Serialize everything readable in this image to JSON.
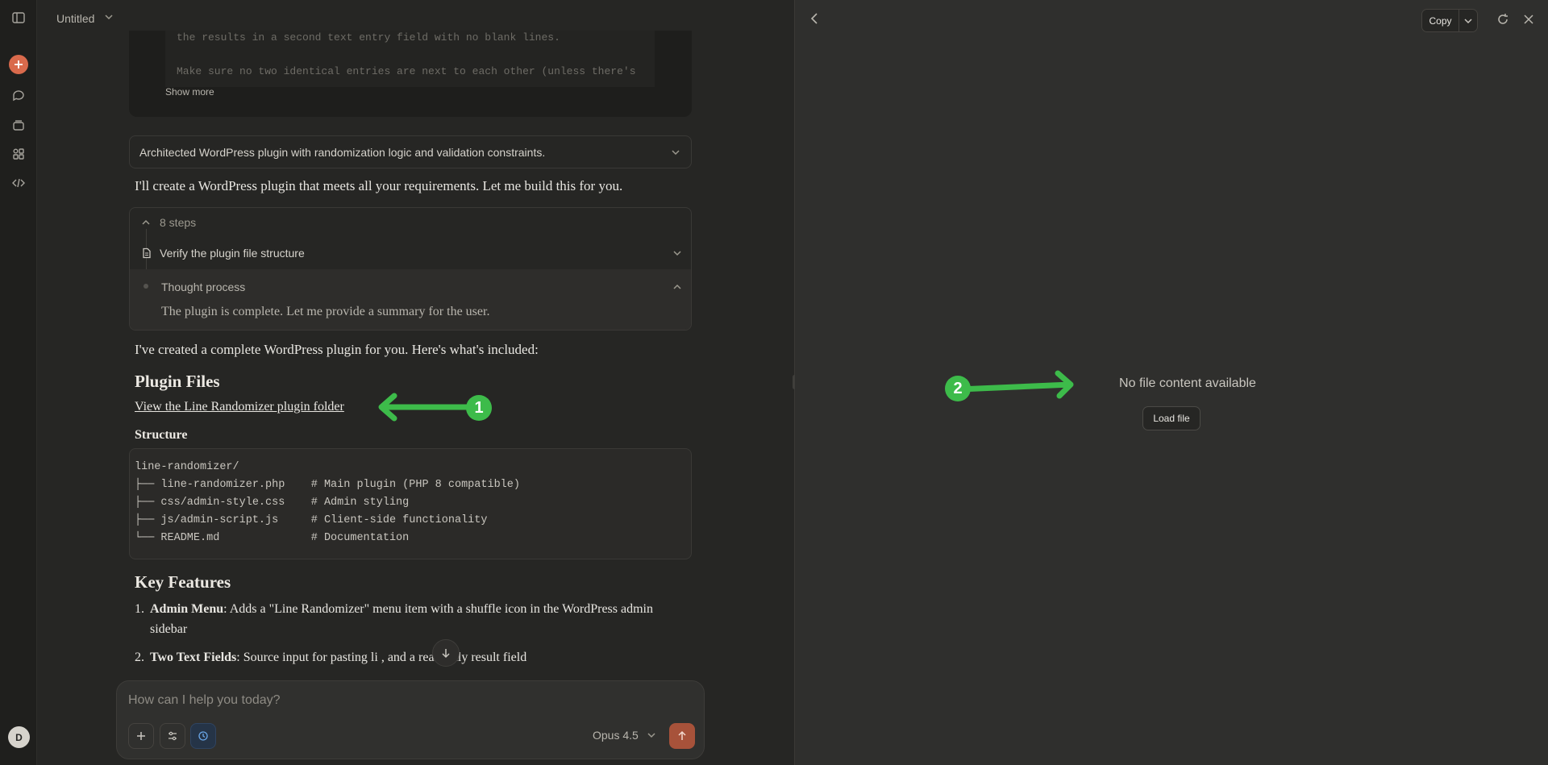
{
  "chat": {
    "title": "Untitled",
    "user_message_lines": [
      "the results in a second text entry field with no blank lines.",
      "Make sure no two identical entries are next to each other (unless there's"
    ],
    "show_more": "Show more",
    "thinking_summary": "Architected WordPress plugin with randomization logic and validation constraints.",
    "intro": "I'll create a WordPress plugin that meets all your requirements. Let me build this for you.",
    "steps": {
      "count_label": "8 steps",
      "verify_label": "Verify the plugin file structure",
      "thought_title": "Thought process",
      "thought_text": "The plugin is complete. Let me provide a summary for the user."
    },
    "created": "I've created a complete WordPress plugin for you. Here's what's included:",
    "plugin_files_heading": "Plugin Files",
    "folder_link": "View the Line Randomizer plugin folder",
    "structure_heading": "Structure",
    "code_lines": [
      "line-randomizer/",
      "├── line-randomizer.php    # Main plugin (PHP 8 compatible)",
      "├── css/admin-style.css    # Admin styling",
      "├── js/admin-script.js     # Client-side functionality",
      "└── README.md              # Documentation"
    ],
    "key_features_heading": "Key Features",
    "features": [
      {
        "num": "1.",
        "title": "Admin Menu",
        "text": ": Adds a \"Line Randomizer\" menu item with a shuffle icon in the WordPress admin sidebar"
      },
      {
        "num": "2.",
        "title": "Two Text Fields",
        "text": ": Source input for pasting li   , and a read-only result field"
      }
    ],
    "composer_placeholder": "How can I help you today?",
    "model": "Opus 4.5"
  },
  "user": {
    "avatar_initial": "D"
  },
  "preview": {
    "copy_label": "Copy",
    "empty_message": "No file content available",
    "load_button": "Load file"
  },
  "annotations": {
    "badge_1": "1",
    "badge_2": "2",
    "arrow_color": "#3dbb4a"
  },
  "colors": {
    "accent": "#d96a4c",
    "send": "#a7523a",
    "background": "#262624",
    "panel": "#2f2f2d"
  }
}
